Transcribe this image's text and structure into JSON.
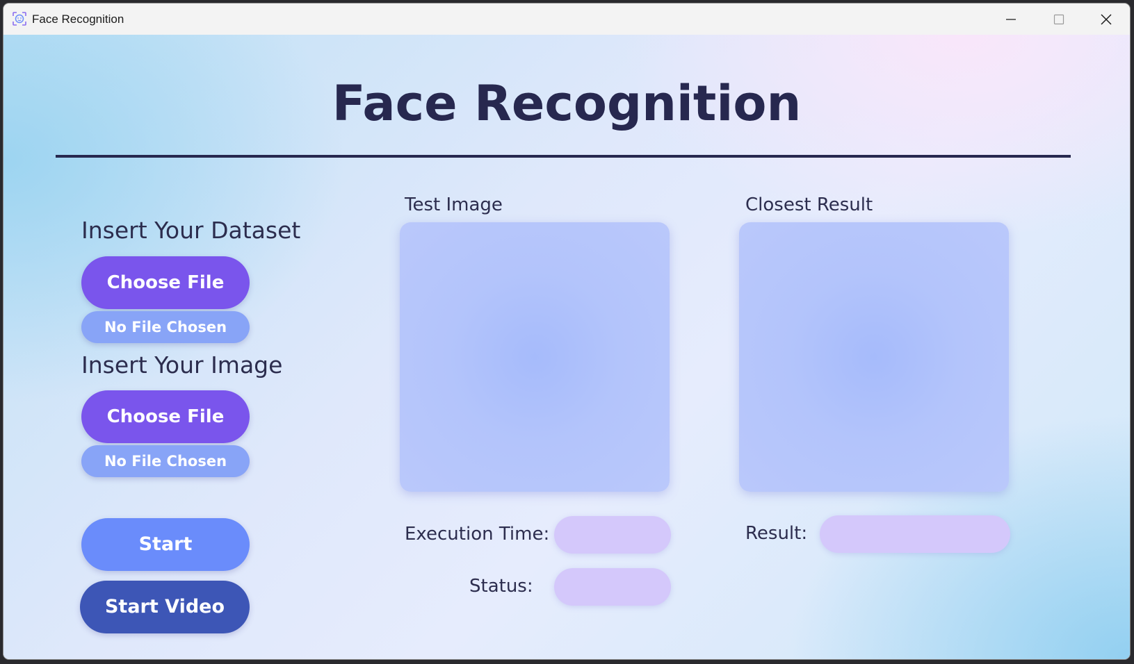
{
  "window": {
    "title": "Face Recognition",
    "icon": "face-scan-icon"
  },
  "header": {
    "title": "Face Recognition"
  },
  "dataset": {
    "label": "Insert Your Dataset",
    "button_label": "Choose File",
    "file_status": "No File Chosen"
  },
  "image_input": {
    "label": "Insert Your Image",
    "button_label": "Choose File",
    "file_status": "No File Chosen"
  },
  "actions": {
    "start_label": "Start",
    "start_video_label": "Start Video"
  },
  "panels": {
    "test_image_label": "Test Image",
    "closest_result_label": "Closest Result"
  },
  "fields": {
    "execution_time_label": "Execution Time:",
    "execution_time_value": "",
    "status_label": "Status:",
    "status_value": "",
    "result_label": "Result:",
    "result_value": ""
  },
  "colors": {
    "title": "#27284f",
    "choose_button": "#7a55ec",
    "no_file_pill": "#88a4f7",
    "start_button": "#6a8cfb",
    "start_video_button": "#3d56b6",
    "value_pill": "#d4c8fb"
  }
}
